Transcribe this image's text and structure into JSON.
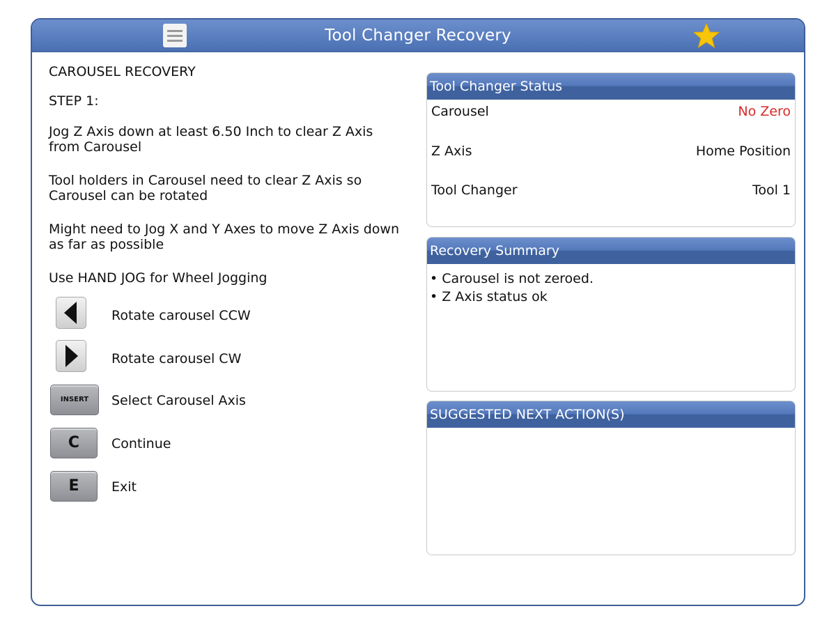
{
  "window": {
    "title": "Tool Changer Recovery"
  },
  "icons": {
    "menu": "hamburger-menu-icon",
    "favorite": "star-icon"
  },
  "colors": {
    "titlebar": "#5a7fc2",
    "error": "#d42a2a",
    "star": "#f7c50a"
  },
  "instructions": {
    "heading": "CAROUSEL RECOVERY",
    "step": "STEP 1:",
    "paragraphs": [
      "Jog Z Axis down at least 6.50 Inch to clear Z Axis from Carousel",
      "Tool holders in Carousel need to clear Z Axis so Carousel can be rotated",
      "Might need to Jog X and Y Axes to move Z Axis down as far as possible",
      "Use HAND JOG for Wheel Jogging"
    ]
  },
  "keys": [
    {
      "key": "◀",
      "label": "Rotate carousel CCW"
    },
    {
      "key": "▶",
      "label": "Rotate carousel CW"
    },
    {
      "key": "INSERT",
      "label": "Select Carousel Axis"
    },
    {
      "key": "C",
      "label": "Continue"
    },
    {
      "key": "E",
      "label": "Exit"
    }
  ],
  "status": {
    "title": "Tool Changer Status",
    "rows": [
      {
        "label": "Carousel",
        "value": "No Zero"
      },
      {
        "label": "Z Axis",
        "value": "Home Position"
      },
      {
        "label": "Tool Changer",
        "value": "Tool 1"
      }
    ]
  },
  "summary": {
    "title": "Recovery Summary",
    "lines": [
      "• Carousel is not zeroed.",
      "• Z Axis status ok"
    ]
  },
  "suggested": {
    "title": "SUGGESTED NEXT ACTION(S)"
  }
}
